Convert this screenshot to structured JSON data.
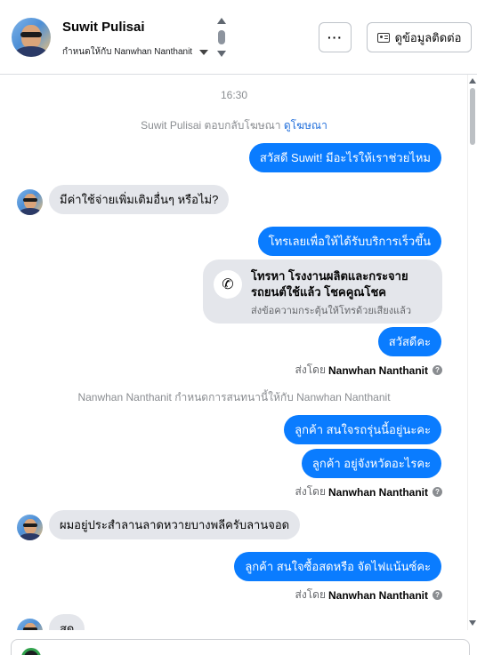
{
  "header": {
    "contact_name": "Suwit Pulisai",
    "assign_text": "กำหนดให้กับ Nanwhan Nanthanit",
    "more_label": "···",
    "contact_button_label": "ดูข้อมูลติดต่อ"
  },
  "thread": {
    "time": "16:30",
    "ad_reply_prefix": "Suwit Pulisai ตอบกลับโฆษณา",
    "ad_reply_link": "ดูโฆษณา",
    "assign_note": "Nanwhan Nanthanit กำหนดการสนทนานี้ให้กับ Nanwhan Nanthanit",
    "messages": [
      {
        "dir": "out",
        "text": "สวัสดี Suwit! มีอะไรให้เราช่วยไหม"
      },
      {
        "dir": "in",
        "text": "มีค่าใช้จ่ายเพิ่มเติมอื่นๆ หรือไม่?"
      },
      {
        "dir": "out",
        "text": "โทรเลยเพื่อให้ได้รับบริการเร็วขึ้น"
      },
      {
        "dir": "out",
        "text": "สวัสดีคะ"
      },
      {
        "dir": "out",
        "text": "ลูกค้า สนใจรถรุ่นนี้อยู่นะคะ"
      },
      {
        "dir": "out",
        "text": "ลูกค้า อยู่จังหวัดอะไรคะ"
      },
      {
        "dir": "in",
        "text": "ผมอยู่ประสำลานลาดหวายบางพลีครับลานจอด"
      },
      {
        "dir": "out",
        "text": "ลูกค้า สนใจซื้อสดหรือ จัดไฟแน้นซ์คะ"
      },
      {
        "dir": "in",
        "text": "สด"
      }
    ],
    "call_card": {
      "title": "โทรหา โรงงานผลิตและกระจายรถยนต์ใช้แล้ว โชคคูณโชค",
      "subtitle": "ส่งข้อความกระตุ้นให้โทรด้วยเสียงแล้ว"
    },
    "sent_by_prefix": "ส่งโดย",
    "sent_by_name": "Nanwhan Nanthanit",
    "help_mark": "?"
  },
  "colors": {
    "outgoing_bubble": "#0a7cff",
    "incoming_bubble": "#e4e6eb",
    "link": "#216fdb"
  },
  "icons": {
    "more": "ellipsis-icon",
    "contact": "contact-card-icon",
    "phone": "phone-icon",
    "help": "help-circle-icon"
  }
}
